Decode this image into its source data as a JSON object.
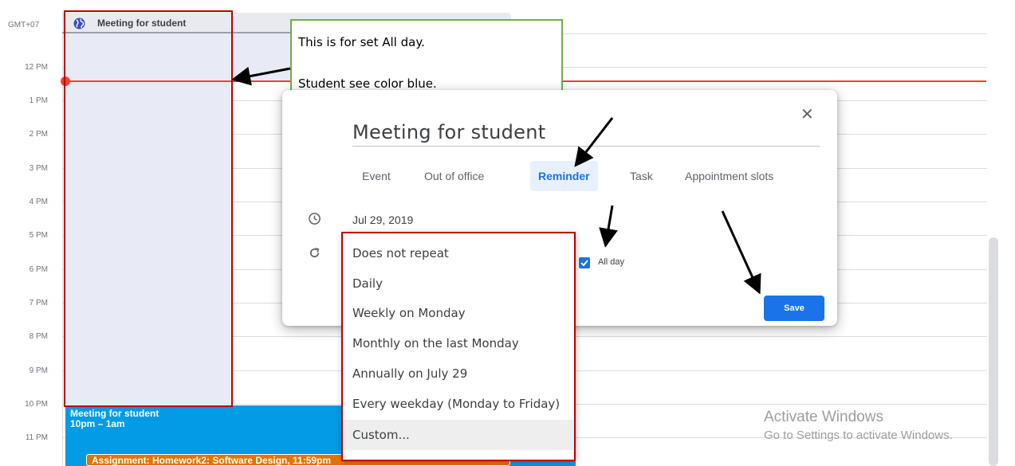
{
  "timezone": "GMT+07",
  "hours": [
    "12 PM",
    "1 PM",
    "2 PM",
    "3 PM",
    "4 PM",
    "5 PM",
    "6 PM",
    "7 PM",
    "8 PM",
    "9 PM",
    "10 PM",
    "11 PM"
  ],
  "allday_event": {
    "title": "Meeting for student"
  },
  "callout": {
    "line1": "This is for set All day.",
    "line2": "Student see color blue."
  },
  "dialog": {
    "title": "Meeting for student",
    "tabs": [
      "Event",
      "Out of office",
      "Reminder",
      "Task",
      "Appointment slots"
    ],
    "active_tab": "Reminder",
    "date": "Jul 29, 2019",
    "allday_label": "All day",
    "allday_checked": true,
    "save_label": "Save",
    "close_icon": "close-icon"
  },
  "repeat_options": [
    "Does not repeat",
    "Daily",
    "Weekly on Monday",
    "Monthly on the last Monday",
    "Annually on July 29",
    "Every weekday (Monday to Friday)",
    "Custom..."
  ],
  "selected_repeat": "Custom...",
  "events": {
    "blue_title": "Meeting for student",
    "blue_time": "10pm – 1am",
    "orange_title": "Assignment: Homework2: Software Design, 11:59pm"
  },
  "watermark": {
    "line1": "Activate Windows",
    "line2": "Go to Settings to activate Windows."
  },
  "colors": {
    "accent": "#1a73e8",
    "now_line": "#ea4335",
    "event_blue": "#039be5",
    "event_orange": "#e37400",
    "highlight_box": "#c00000",
    "callout_border": "#70ad47"
  }
}
